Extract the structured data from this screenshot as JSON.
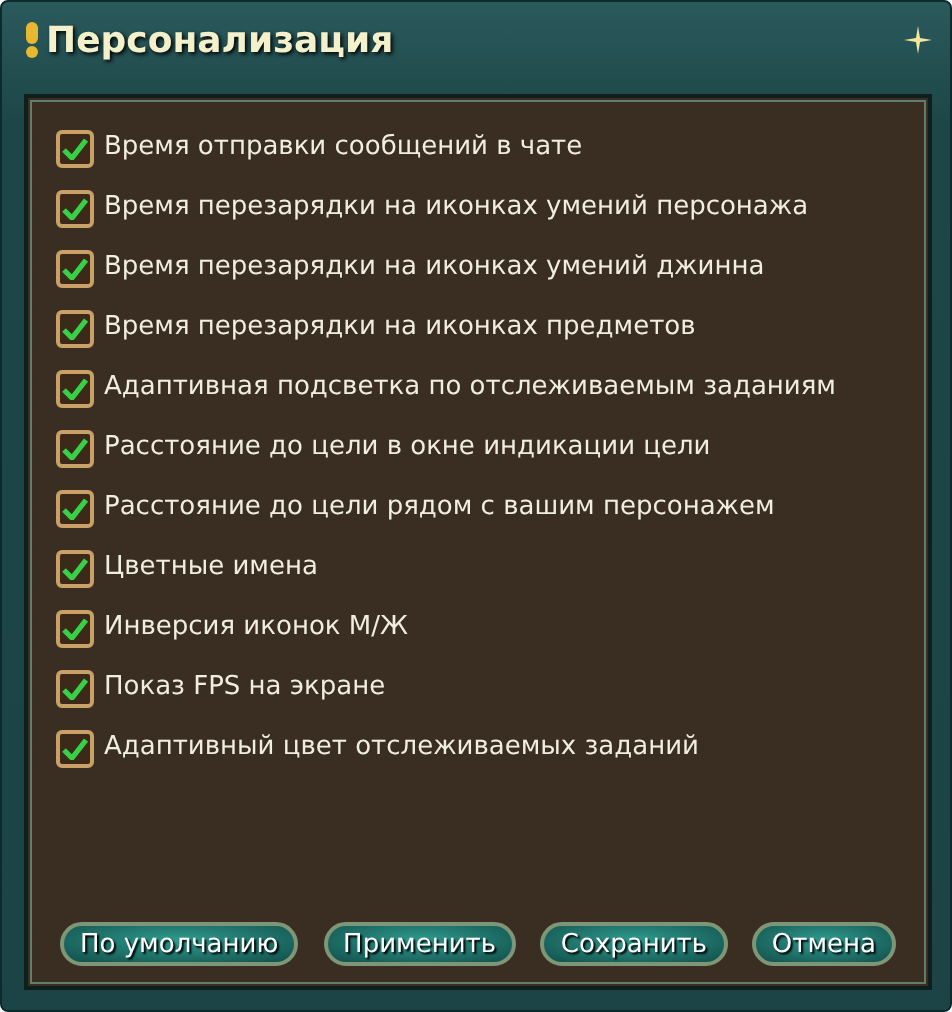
{
  "window": {
    "title": "Персонализация"
  },
  "options": [
    {
      "label": "Время отправки сообщений в чате",
      "checked": true
    },
    {
      "label": "Время перезарядки на иконках умений персонажа",
      "checked": true
    },
    {
      "label": "Время перезарядки на иконках умений джинна",
      "checked": true
    },
    {
      "label": "Время перезарядки на иконках предметов",
      "checked": true
    },
    {
      "label": "Адаптивная подсветка по отслеживаемым заданиям",
      "checked": true
    },
    {
      "label": "Расстояние до цели в окне индикации цели",
      "checked": true
    },
    {
      "label": "Расстояние до цели рядом с вашим персонажем",
      "checked": true
    },
    {
      "label": "Цветные имена",
      "checked": true
    },
    {
      "label": "Инверсия иконок М/Ж",
      "checked": true
    },
    {
      "label": "Показ FPS на экране",
      "checked": true
    },
    {
      "label": "Адаптивный цвет отслеживаемых заданий",
      "checked": true
    }
  ],
  "buttons": [
    "По умолчанию",
    "Применить",
    "Сохранить",
    "Отмена"
  ]
}
